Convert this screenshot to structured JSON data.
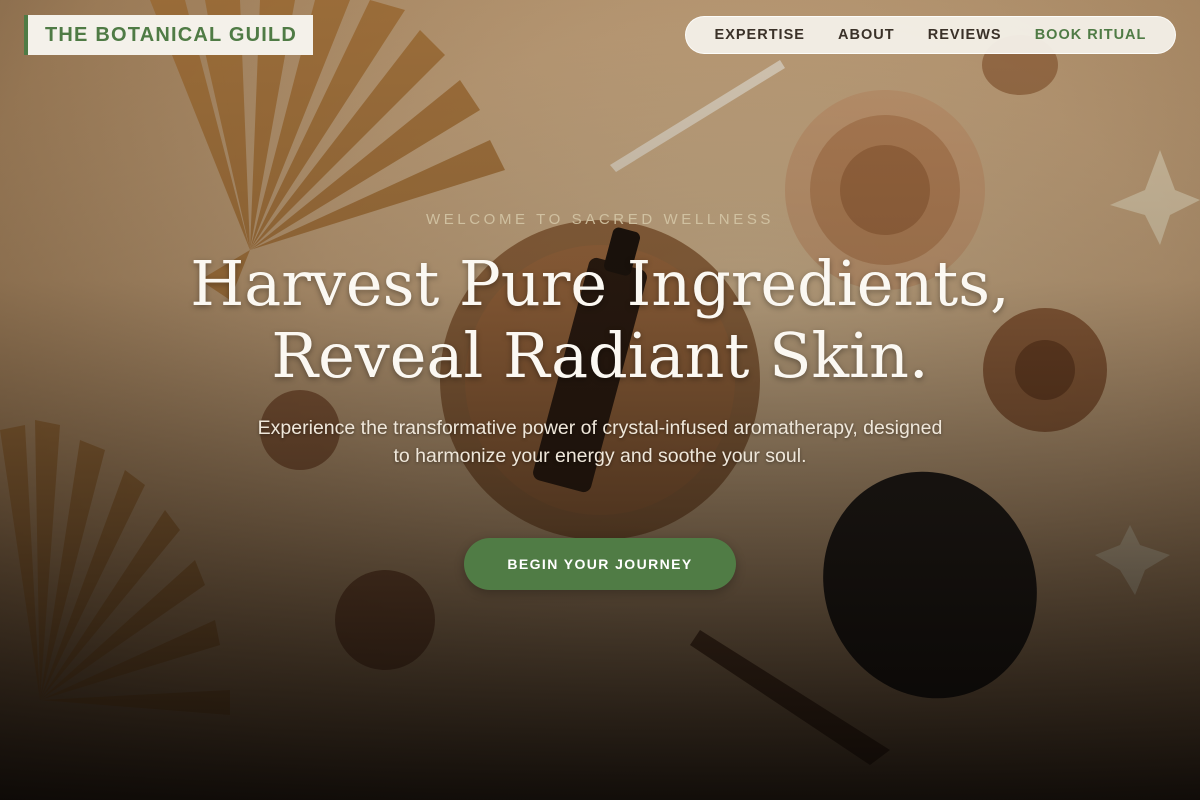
{
  "brand": {
    "name": "THE BOTANICAL GUILD",
    "accent_color": "#4f7b45"
  },
  "nav": {
    "items": [
      {
        "label": "EXPERTISE"
      },
      {
        "label": "ABOUT"
      },
      {
        "label": "REVIEWS"
      },
      {
        "label": "BOOK RITUAL"
      }
    ]
  },
  "hero": {
    "eyebrow": "WELCOME TO SACRED WELLNESS",
    "headline_line1": "Harvest Pure Ingredients,",
    "headline_line2": "Reveal Radiant Skin.",
    "subtext": "Experience the transformative power of crystal-infused aromatherapy, designed to harmonize your energy and soothe your soul.",
    "cta_label": "BEGIN YOUR JOURNEY",
    "cta_color": "#507c45"
  }
}
